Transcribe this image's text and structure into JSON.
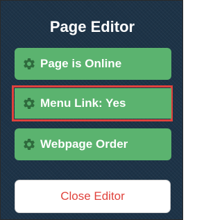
{
  "panel": {
    "title": "Page Editor"
  },
  "buttons": [
    {
      "label": "Page is Online",
      "icon": "gear-icon"
    },
    {
      "label": "Menu Link: Yes",
      "icon": "gear-icon",
      "highlighted": true
    },
    {
      "label": "Webpage Order",
      "icon": "gear-icon"
    }
  ],
  "close": {
    "label": "Close Editor"
  },
  "colors": {
    "panel_bg": "#1d3347",
    "button_green": "#5bb36f",
    "highlight_red": "#e0423c",
    "close_text": "#e0423c",
    "gear": "#2f6b3d"
  }
}
